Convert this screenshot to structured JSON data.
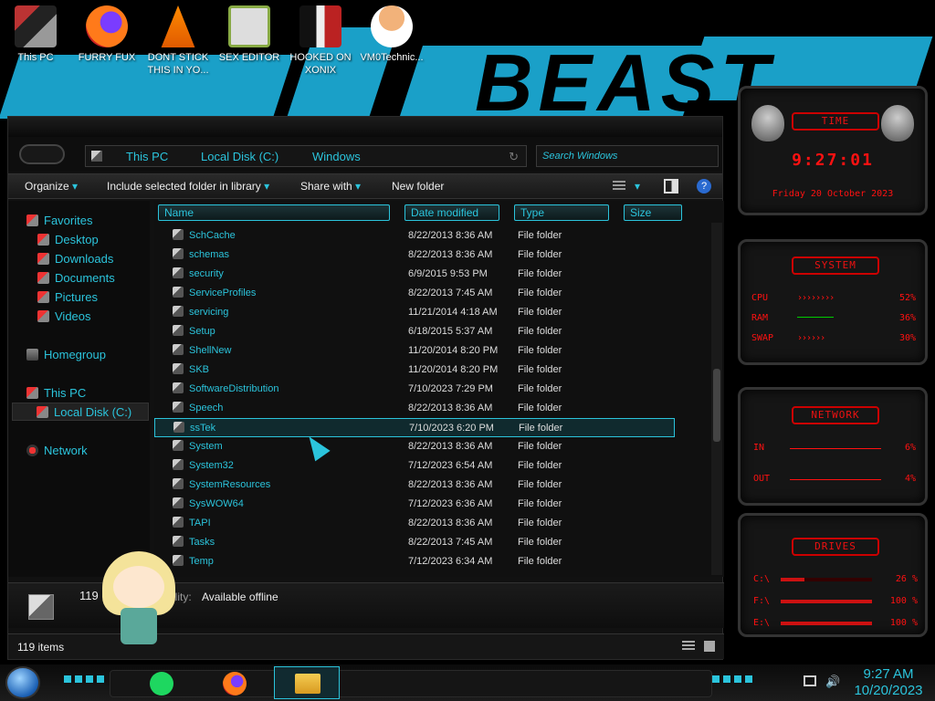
{
  "desktop": {
    "icons": [
      {
        "label": "This PC",
        "icon": "this-pc-icon"
      },
      {
        "label": "FURRY FUX",
        "icon": "firefox-icon"
      },
      {
        "label": "DONT STICK THIS IN YO...",
        "icon": "vlc-icon"
      },
      {
        "label": "SEX EDITOR",
        "icon": "hxd-editor-icon"
      },
      {
        "label": "HOOKED ON XONIX",
        "icon": "xonix-game-icon"
      },
      {
        "label": "VM0Technic...",
        "icon": "doctor-avatar-icon"
      }
    ],
    "wallpaper_text": "BEAST"
  },
  "explorer": {
    "breadcrumb": [
      "This PC",
      "Local Disk (C:)",
      "Windows"
    ],
    "search_placeholder": "Search Windows",
    "toolbar": {
      "organize": "Organize",
      "include": "Include selected folder in library",
      "share": "Share with",
      "new_folder": "New folder"
    },
    "columns": [
      "Name",
      "Date modified",
      "Type",
      "Size"
    ],
    "nav": {
      "favorites": "Favorites",
      "desktop": "Desktop",
      "downloads": "Downloads",
      "documents": "Documents",
      "pictures": "Pictures",
      "videos": "Videos",
      "homegroup": "Homegroup",
      "this_pc": "This PC",
      "local_disk": "Local Disk (C:)",
      "network": "Network"
    },
    "files": [
      {
        "name": "SchCache",
        "date": "8/22/2013 8:36 AM",
        "type": "File folder"
      },
      {
        "name": "schemas",
        "date": "8/22/2013 8:36 AM",
        "type": "File folder"
      },
      {
        "name": "security",
        "date": "6/9/2015 9:53 PM",
        "type": "File folder"
      },
      {
        "name": "ServiceProfiles",
        "date": "8/22/2013 7:45 AM",
        "type": "File folder"
      },
      {
        "name": "servicing",
        "date": "11/21/2014 4:18 AM",
        "type": "File folder"
      },
      {
        "name": "Setup",
        "date": "6/18/2015 5:37 AM",
        "type": "File folder"
      },
      {
        "name": "ShellNew",
        "date": "11/20/2014 8:20 PM",
        "type": "File folder"
      },
      {
        "name": "SKB",
        "date": "11/20/2014 8:20 PM",
        "type": "File folder"
      },
      {
        "name": "SoftwareDistribution",
        "date": "7/10/2023 7:29 PM",
        "type": "File folder"
      },
      {
        "name": "Speech",
        "date": "8/22/2013 8:36 AM",
        "type": "File folder"
      },
      {
        "name": "ssTek",
        "date": "7/10/2023 6:20 PM",
        "type": "File folder"
      },
      {
        "name": "System",
        "date": "8/22/2013 8:36 AM",
        "type": "File folder"
      },
      {
        "name": "System32",
        "date": "7/12/2023 6:54 AM",
        "type": "File folder"
      },
      {
        "name": "SystemResources",
        "date": "8/22/2013 8:36 AM",
        "type": "File folder"
      },
      {
        "name": "SysWOW64",
        "date": "7/12/2023 6:36 AM",
        "type": "File folder"
      },
      {
        "name": "TAPI",
        "date": "8/22/2013 8:36 AM",
        "type": "File folder"
      },
      {
        "name": "Tasks",
        "date": "8/22/2013 7:45 AM",
        "type": "File folder"
      },
      {
        "name": "Temp",
        "date": "7/12/2023 6:34 AM",
        "type": "File folder"
      }
    ],
    "selected_index": 10,
    "details": {
      "count": "119",
      "availability_label": "ility:",
      "availability": "Available offline"
    },
    "status": "119 items"
  },
  "widgets": {
    "time": {
      "title": "TIME",
      "clock": "9:27:01",
      "date": "Friday 20 October 2023"
    },
    "system": {
      "title": "SYSTEM",
      "rows": [
        {
          "label": "CPU",
          "value": "52%"
        },
        {
          "label": "RAM",
          "value": "36%"
        },
        {
          "label": "SWAP",
          "value": "30%"
        }
      ]
    },
    "network": {
      "title": "NETWORK",
      "rows": [
        {
          "label": "IN",
          "value": "6%"
        },
        {
          "label": "OUT",
          "value": "4%"
        }
      ]
    },
    "drives": {
      "title": "DRIVES",
      "rows": [
        {
          "label": "C:\\",
          "value": "26 %"
        },
        {
          "label": "F:\\",
          "value": "100 %"
        },
        {
          "label": "E:\\",
          "value": "100 %"
        }
      ]
    }
  },
  "taskbar": {
    "time": "9:27 AM",
    "date": "10/20/2023"
  },
  "colors": {
    "accent": "#2bc4dc",
    "alert": "#ff1111",
    "wallpaper": "#1aa0c8"
  }
}
